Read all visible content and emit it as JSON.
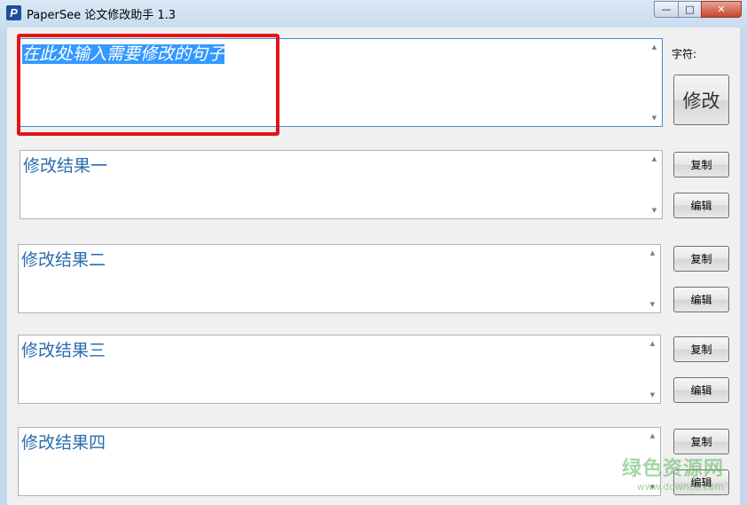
{
  "window": {
    "title": "PaperSee 论文修改助手 1.3",
    "icon_letter": "P",
    "minimize_glyph": "—",
    "maximize_glyph": "□",
    "close_glyph": "✕"
  },
  "input": {
    "text": "在此处输入需要修改的句子"
  },
  "char_label": "字符:",
  "modify_button": "修改",
  "results": [
    {
      "text": "修改结果一",
      "copy": "复制",
      "edit": "编辑"
    },
    {
      "text": "修改结果二",
      "copy": "复制",
      "edit": "编辑"
    },
    {
      "text": "修改结果三",
      "copy": "复制",
      "edit": "编辑"
    },
    {
      "text": "修改结果四",
      "copy": "复制",
      "edit": "编辑"
    }
  ],
  "scroll": {
    "up": "▲",
    "down": "▼"
  },
  "watermark": {
    "line1": "绿色资源网",
    "line2": "www.downcc.com"
  },
  "colors": {
    "highlight": "#e3141a",
    "result_text": "#2b6dad",
    "selection": "#3399ff"
  }
}
